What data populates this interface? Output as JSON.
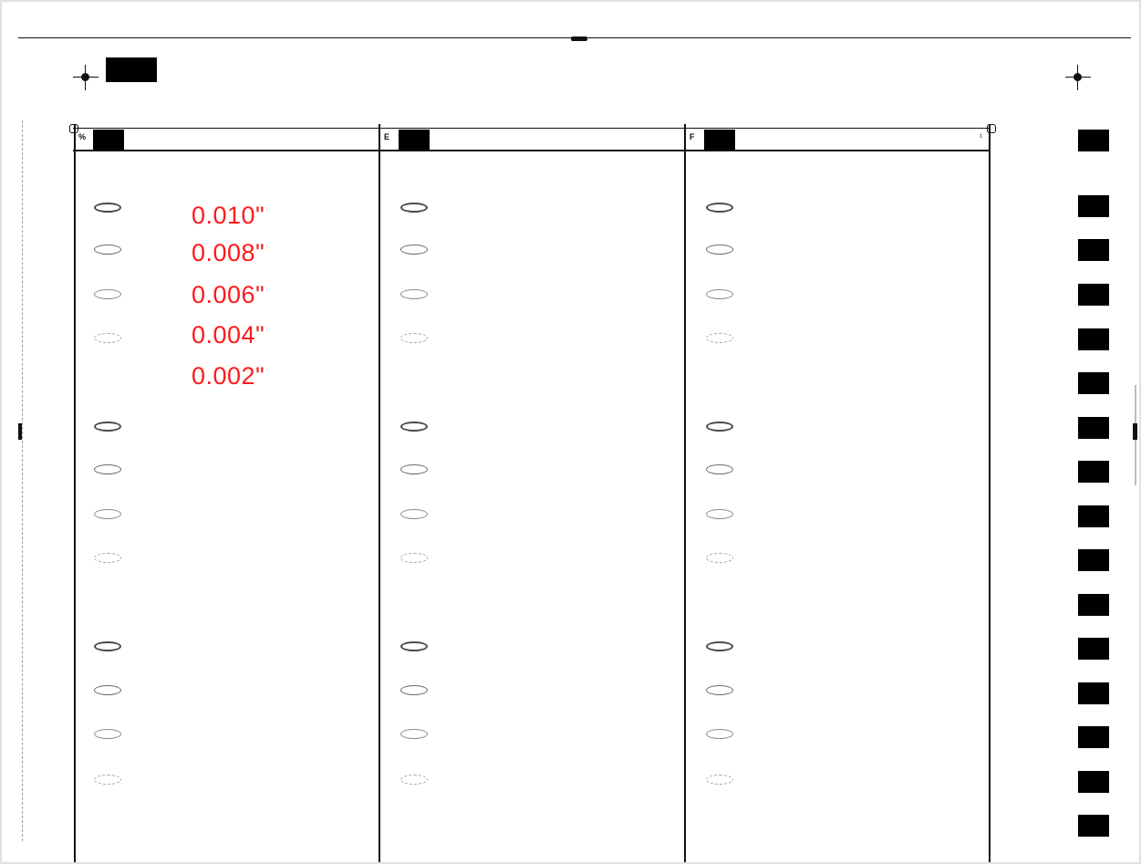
{
  "form": {
    "columns": [
      {
        "label": "%"
      },
      {
        "label": "E"
      },
      {
        "label": "F"
      }
    ],
    "corner_tick": "¹"
  },
  "annotations": [
    {
      "text": "0.010\""
    },
    {
      "text": "0.008\""
    },
    {
      "text": "0.006\""
    },
    {
      "text": "0.004\""
    },
    {
      "text": "0.002\""
    }
  ],
  "annotation_color": "#ff1a1a"
}
